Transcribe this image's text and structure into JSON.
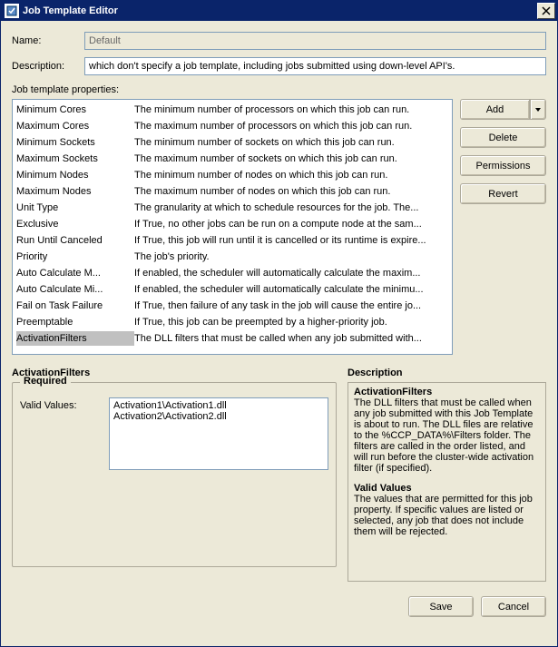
{
  "window": {
    "title": "Job Template Editor"
  },
  "fields": {
    "name_label": "Name:",
    "name_value": "Default",
    "description_label": "Description:",
    "description_value": "which don't specify a job template, including jobs submitted using down-level API's."
  },
  "props_label": "Job template properties:",
  "properties": [
    {
      "name": "Minimum Cores",
      "desc": "The minimum number of processors on which this job can run."
    },
    {
      "name": "Maximum Cores",
      "desc": "The maximum number of processors on which this job can run."
    },
    {
      "name": "Minimum Sockets",
      "desc": "The minimum number of sockets on which this job can run."
    },
    {
      "name": "Maximum Sockets",
      "desc": "The maximum number of sockets on which this job can run."
    },
    {
      "name": "Minimum Nodes",
      "desc": "The minimum number of nodes on which this job can run."
    },
    {
      "name": "Maximum Nodes",
      "desc": "The maximum number of nodes on which this job can run."
    },
    {
      "name": "Unit Type",
      "desc": "The granularity at which to schedule resources for the job.  The..."
    },
    {
      "name": "Exclusive",
      "desc": "If True, no other jobs can be run on a compute node at the sam..."
    },
    {
      "name": "Run Until Canceled",
      "desc": "If True, this job will run until it is cancelled or its runtime is expire..."
    },
    {
      "name": "Priority",
      "desc": "The job's priority."
    },
    {
      "name": "Auto Calculate M...",
      "desc": "If enabled, the scheduler will automatically calculate the maxim..."
    },
    {
      "name": "Auto Calculate Mi...",
      "desc": "If enabled, the scheduler will automatically calculate the minimu..."
    },
    {
      "name": "Fail on Task Failure",
      "desc": "If True, then failure of any task in the job will cause the entire jo..."
    },
    {
      "name": "Preemptable",
      "desc": "If True, this job can be preempted by a higher-priority job."
    },
    {
      "name": "ActivationFilters",
      "desc": "The DLL filters that must be called when any job submitted with..."
    }
  ],
  "selected_index": 14,
  "buttons": {
    "add": "Add",
    "delete": "Delete",
    "permissions": "Permissions",
    "revert": "Revert",
    "save": "Save",
    "cancel": "Cancel"
  },
  "detail": {
    "title": "ActivationFilters",
    "required_label": "Required",
    "valid_values_label": "Valid Values:",
    "valid_values": "Activation1\\Activation1.dll\nActivation2\\Activation2.dll"
  },
  "description_panel": {
    "heading": "Description",
    "title1": "ActivationFilters",
    "body1": "The DLL filters that must be called when any job submitted with this Job Template is about to run.  The DLL files are relative to the %CCP_DATA%\\Filters folder.  The filters are called in the order listed, and will run before the cluster-wide activation filter (if specified).",
    "title2": "Valid Values",
    "body2": "The values that are permitted for this job property. If specific values are listed or selected, any job that does not include them will be rejected."
  }
}
